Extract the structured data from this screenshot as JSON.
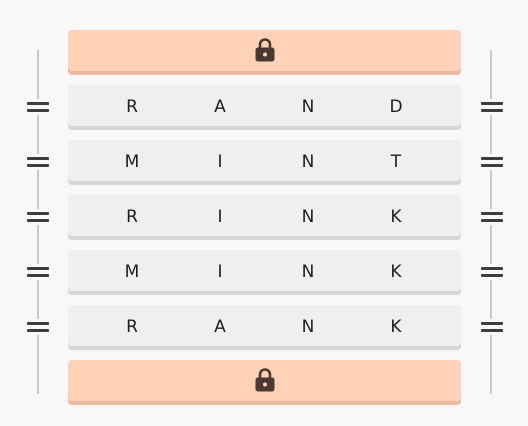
{
  "top_lock": {
    "icon": "lock-icon"
  },
  "bottom_lock": {
    "icon": "lock-icon"
  },
  "rows": [
    {
      "letters": [
        "R",
        "A",
        "N",
        "D"
      ]
    },
    {
      "letters": [
        "M",
        "I",
        "N",
        "T"
      ]
    },
    {
      "letters": [
        "R",
        "I",
        "N",
        "K"
      ]
    },
    {
      "letters": [
        "M",
        "I",
        "N",
        "K"
      ]
    },
    {
      "letters": [
        "R",
        "A",
        "N",
        "K"
      ]
    }
  ],
  "colors": {
    "lock_bar": "#ffd1b7",
    "row_tile": "#efeff0",
    "text": "#1e1e20"
  }
}
